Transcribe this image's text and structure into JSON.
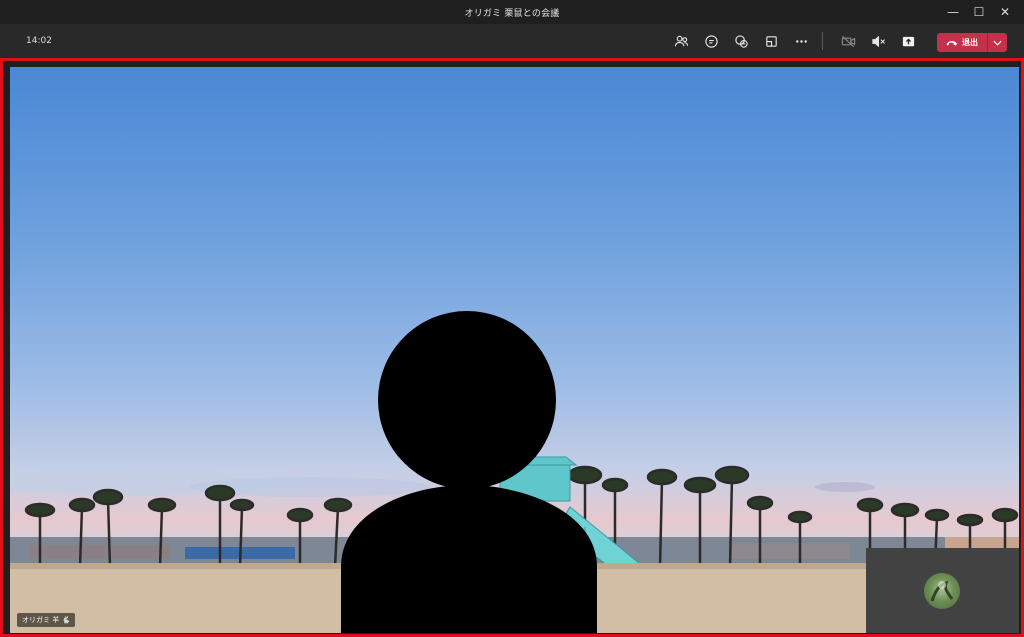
{
  "window": {
    "title": "オリガミ 栗鼠との会議",
    "controls": {
      "minimize": "—",
      "maximize": "☐",
      "close": "✕"
    }
  },
  "toolbar": {
    "timer": "14:02",
    "icons": [
      "participants-icon",
      "chat-icon",
      "reactions-icon",
      "share-tray-icon",
      "more-options-icon",
      "camera-off-icon",
      "speaker-mute-icon",
      "share-content-icon"
    ],
    "leave_label": "退出"
  },
  "stage": {
    "participant_name": "オリガミ 羊 🐇"
  },
  "colors": {
    "leave_button": "#c4314b",
    "stage_highlight": "#e0101a",
    "toolbar_bg": "#292929"
  }
}
